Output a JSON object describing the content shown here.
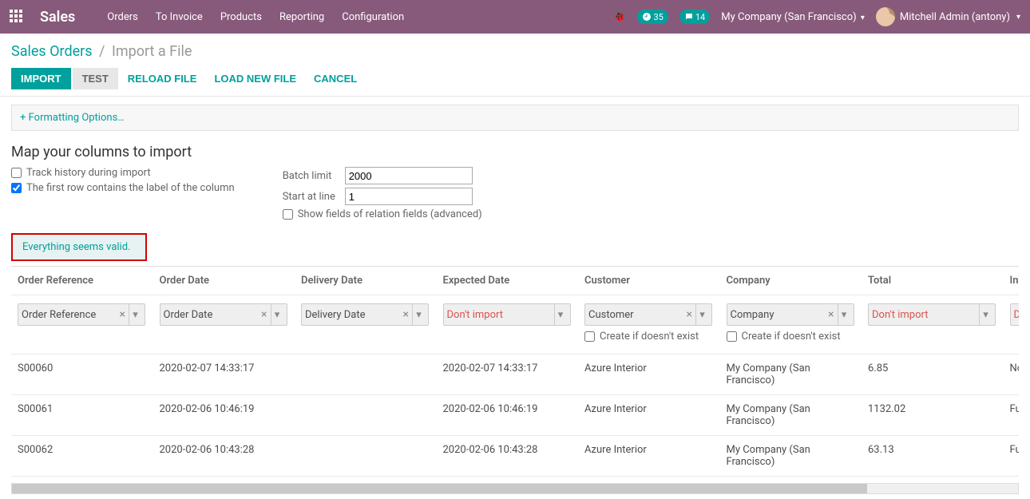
{
  "nav": {
    "brand": "Sales",
    "menu": [
      "Orders",
      "To Invoice",
      "Products",
      "Reporting",
      "Configuration"
    ],
    "clock_badge": "35",
    "chat_badge": "14",
    "company": "My Company (San Francisco)",
    "user": "Mitchell Admin (antony)"
  },
  "breadcrumb": {
    "root": "Sales Orders",
    "current": "Import a File"
  },
  "buttons": {
    "import": "Import",
    "test": "Test",
    "reload": "Reload file",
    "load_new": "Load new file",
    "cancel": "Cancel"
  },
  "options": {
    "formatting": "+ Formatting Options…"
  },
  "mapping": {
    "title": "Map your columns to import",
    "track_history": "Track history during import",
    "track_history_checked": false,
    "first_row_labels": "The first row contains the label of the column",
    "first_row_checked": true,
    "batch_limit_label": "Batch limit",
    "batch_limit_value": "2000",
    "start_at_label": "Start at line",
    "start_at_value": "1",
    "show_fields_label": "Show fields of relation fields (advanced)",
    "show_fields_checked": false
  },
  "status": {
    "message": "Everything seems valid."
  },
  "table": {
    "headers": [
      "Order Reference",
      "Order Date",
      "Delivery Date",
      "Expected Date",
      "Customer",
      "Company",
      "Total",
      "Invoice Status"
    ],
    "field_map": [
      {
        "value": "Order Reference",
        "clearable": true,
        "dont": false,
        "create_if": false
      },
      {
        "value": "Order Date",
        "clearable": true,
        "dont": false,
        "create_if": false
      },
      {
        "value": "Delivery Date",
        "clearable": true,
        "dont": false,
        "create_if": false
      },
      {
        "value": "Don't import",
        "clearable": false,
        "dont": true,
        "create_if": false
      },
      {
        "value": "Customer",
        "clearable": true,
        "dont": false,
        "create_if": true,
        "create_label": "Create if doesn't exist"
      },
      {
        "value": "Company",
        "clearable": true,
        "dont": false,
        "create_if": true,
        "create_label": "Create if doesn't exist"
      },
      {
        "value": "Don't import",
        "clearable": false,
        "dont": true,
        "create_if": false
      },
      {
        "value": "Don't import",
        "clearable": false,
        "dont": true,
        "create_if": false
      }
    ],
    "rows": [
      {
        "Order Reference": "S00060",
        "Order Date": "2020-02-07 14:33:17",
        "Delivery Date": "",
        "Expected Date": "2020-02-07 14:33:17",
        "Customer": "Azure Interior",
        "Company": "My Company (San Francisco)",
        "Total": "6.85",
        "Invoice Status": "Nothing to"
      },
      {
        "Order Reference": "S00061",
        "Order Date": "2020-02-06 10:46:19",
        "Delivery Date": "",
        "Expected Date": "2020-02-06 10:46:19",
        "Customer": "Azure Interior",
        "Company": "My Company (San Francisco)",
        "Total": "1132.02",
        "Invoice Status": "Fully Invoic"
      },
      {
        "Order Reference": "S00062",
        "Order Date": "2020-02-06 10:43:28",
        "Delivery Date": "",
        "Expected Date": "2020-02-06 10:43:28",
        "Customer": "Azure Interior",
        "Company": "My Company (San Francisco)",
        "Total": "63.13",
        "Invoice Status": "Fully Invoic"
      }
    ]
  }
}
